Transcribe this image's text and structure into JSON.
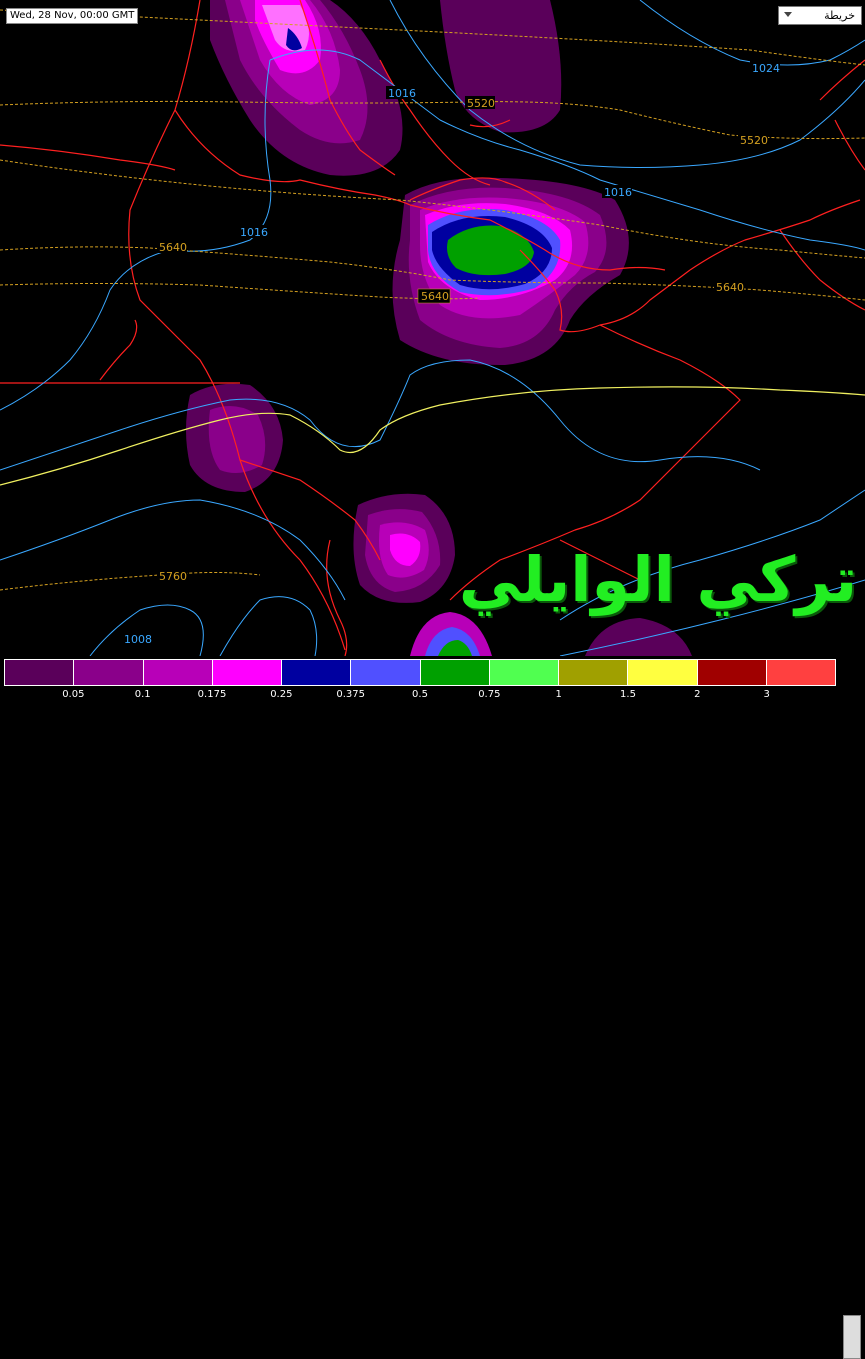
{
  "header": {
    "timestamp": "Wed, 28 Nov, 00:00 GMT"
  },
  "layer_selector": {
    "selected": "خريطة"
  },
  "watermark": {
    "text": "تركي الوايلي"
  },
  "isobar_labels": [
    "1016",
    "1016",
    "1016",
    "1024",
    "1008"
  ],
  "height_labels": [
    "5520",
    "5520",
    "5640",
    "5640",
    "5640",
    "5760"
  ],
  "legend": {
    "swatches": [
      "#5a005a",
      "#8a008a",
      "#b800b8",
      "#ff00ff",
      "#0000a0",
      "#5050ff",
      "#00a000",
      "#50ff50",
      "#a0a000",
      "#ffff40",
      "#a00000",
      "#ff4040"
    ],
    "labels": [
      "0.05",
      "0.1",
      "0.175",
      "0.25",
      "0.375",
      "0.5",
      "0.75",
      "1",
      "1.5",
      "2",
      "3"
    ]
  },
  "colors": {
    "coastline": "#ff2020",
    "isobar": "#3aa8ff",
    "height_contour": "#d4a020",
    "jet_contour": "#f0f060",
    "background": "#000000"
  }
}
